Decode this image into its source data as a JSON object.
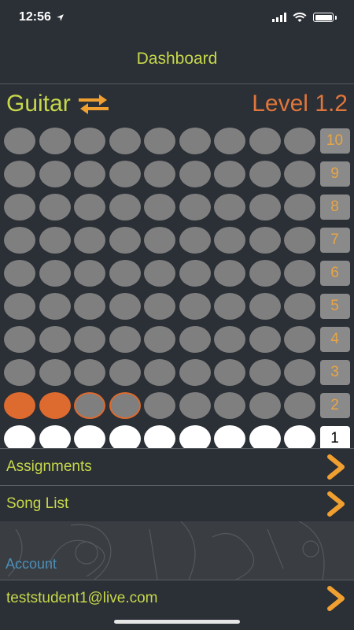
{
  "status": {
    "time": "12:56"
  },
  "nav": {
    "title": "Dashboard"
  },
  "header": {
    "instrument": "Guitar",
    "level": "Level 1.2"
  },
  "grid": {
    "rows": [
      {
        "label": "10",
        "dots": [
          "empty",
          "empty",
          "empty",
          "empty",
          "empty",
          "empty",
          "empty",
          "empty",
          "empty"
        ]
      },
      {
        "label": "9",
        "dots": [
          "empty",
          "empty",
          "empty",
          "empty",
          "empty",
          "empty",
          "empty",
          "empty",
          "empty"
        ]
      },
      {
        "label": "8",
        "dots": [
          "empty",
          "empty",
          "empty",
          "empty",
          "empty",
          "empty",
          "empty",
          "empty",
          "empty"
        ]
      },
      {
        "label": "7",
        "dots": [
          "empty",
          "empty",
          "empty",
          "empty",
          "empty",
          "empty",
          "empty",
          "empty",
          "empty"
        ]
      },
      {
        "label": "6",
        "dots": [
          "empty",
          "empty",
          "empty",
          "empty",
          "empty",
          "empty",
          "empty",
          "empty",
          "empty"
        ]
      },
      {
        "label": "5",
        "dots": [
          "empty",
          "empty",
          "empty",
          "empty",
          "empty",
          "empty",
          "empty",
          "empty",
          "empty"
        ]
      },
      {
        "label": "4",
        "dots": [
          "empty",
          "empty",
          "empty",
          "empty",
          "empty",
          "empty",
          "empty",
          "empty",
          "empty"
        ]
      },
      {
        "label": "3",
        "dots": [
          "empty",
          "empty",
          "empty",
          "empty",
          "empty",
          "empty",
          "empty",
          "empty",
          "empty"
        ]
      },
      {
        "label": "2",
        "dots": [
          "filled",
          "filled",
          "outlined",
          "outlined",
          "empty",
          "empty",
          "empty",
          "empty",
          "empty"
        ]
      },
      {
        "label": "1",
        "dots": [
          "white",
          "white",
          "white",
          "white",
          "white",
          "white",
          "white",
          "white",
          "white"
        ],
        "current": true
      }
    ]
  },
  "menu": {
    "assignments": "Assignments",
    "song_list": "Song List",
    "account_label": "Account",
    "account_email": "teststudent1@live.com"
  },
  "colors": {
    "accent_green": "#c6d84a",
    "accent_orange": "#e0763b",
    "chevron": "#f0a030",
    "background": "#2b2f36"
  },
  "icons": {
    "swap": "swap-arrows-icon",
    "chevron": "chevron-right-icon"
  }
}
